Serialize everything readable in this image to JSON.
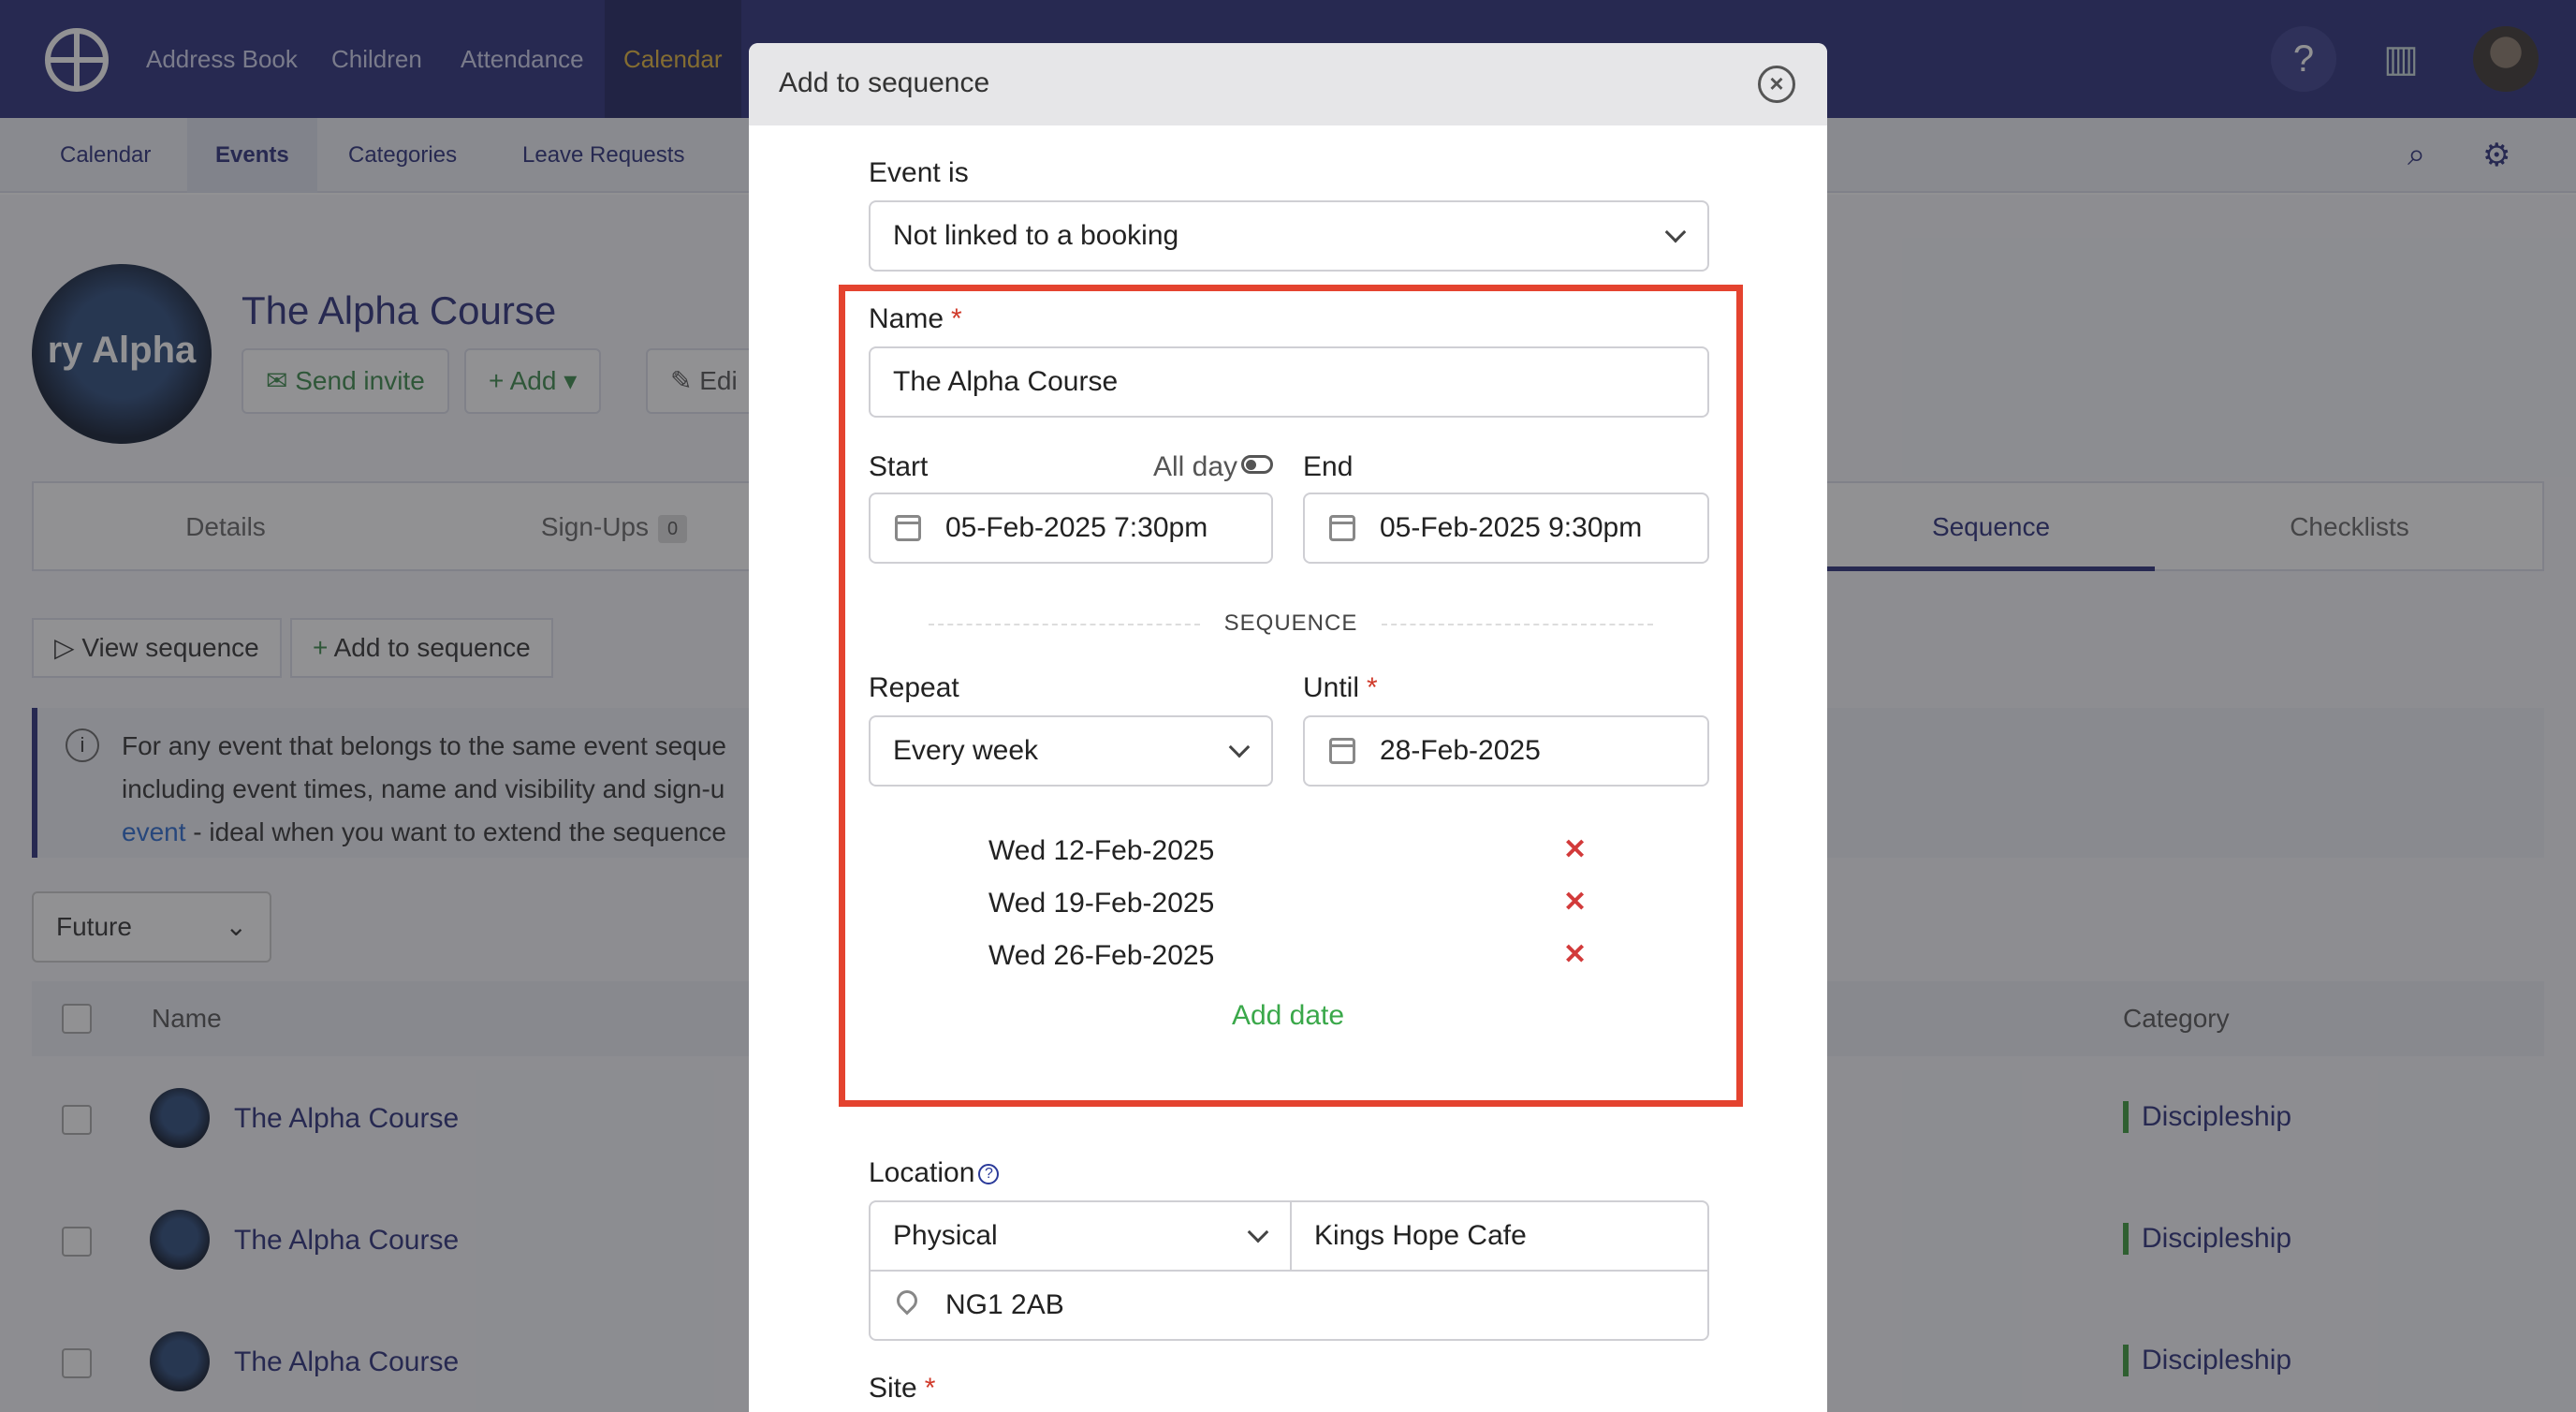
{
  "topnav": {
    "items": [
      "Address Book",
      "Children",
      "Attendance",
      "Calendar"
    ],
    "active": "Calendar"
  },
  "subnav": {
    "items": [
      "Calendar",
      "Events",
      "Categories",
      "Leave Requests"
    ],
    "active": "Events"
  },
  "event": {
    "avatar_text": "ry Alpha",
    "title": "The Alpha Course",
    "actions": [
      "Send invite",
      "Add",
      "Edi"
    ]
  },
  "tabs": {
    "items": [
      "Details",
      "Sign-Ups",
      "Sequence",
      "Checklists"
    ],
    "signups_count": "0",
    "active": "Sequence"
  },
  "sequence_buttons": [
    "View sequence",
    "Add to sequence"
  ],
  "info": {
    "line1": "For any event that belongs to the same event seque",
    "line2": "including event times, name and visibility and sign-u",
    "line3_link": "event",
    "line3_rest": " - ideal when you want to extend the sequence"
  },
  "filter": {
    "selected": "Future"
  },
  "table": {
    "headers": [
      "Name",
      "Category"
    ],
    "rows": [
      {
        "name": "The Alpha Course",
        "category": "Discipleship"
      },
      {
        "name": "The Alpha Course",
        "category": "Discipleship"
      },
      {
        "name": "The Alpha Course",
        "category": "Discipleship"
      }
    ]
  },
  "modal": {
    "title": "Add to sequence",
    "event_is_label": "Event is",
    "event_is_value": "Not linked to a booking",
    "name_label": "Name",
    "name_value": "The Alpha Course",
    "start_label": "Start",
    "allday_label": "All day",
    "end_label": "End",
    "start_value": "05-Feb-2025 7:30pm",
    "end_value": "05-Feb-2025 9:30pm",
    "sequence_label": "SEQUENCE",
    "repeat_label": "Repeat",
    "repeat_value": "Every week",
    "until_label": "Until",
    "until_value": "28-Feb-2025",
    "dates": [
      "Wed 12-Feb-2025",
      "Wed 19-Feb-2025",
      "Wed 26-Feb-2025"
    ],
    "add_date_label": "Add date",
    "location_label": "Location",
    "location_type": "Physical",
    "location_name": "Kings Hope Cafe",
    "postcode": "NG1 2AB",
    "site_label": "Site"
  },
  "colors": {
    "nav": "#2a2f7a",
    "highlight": "#e4432f",
    "required": "#d03a2a",
    "remove": "#d23a3a",
    "add_link": "#3aa84a"
  }
}
